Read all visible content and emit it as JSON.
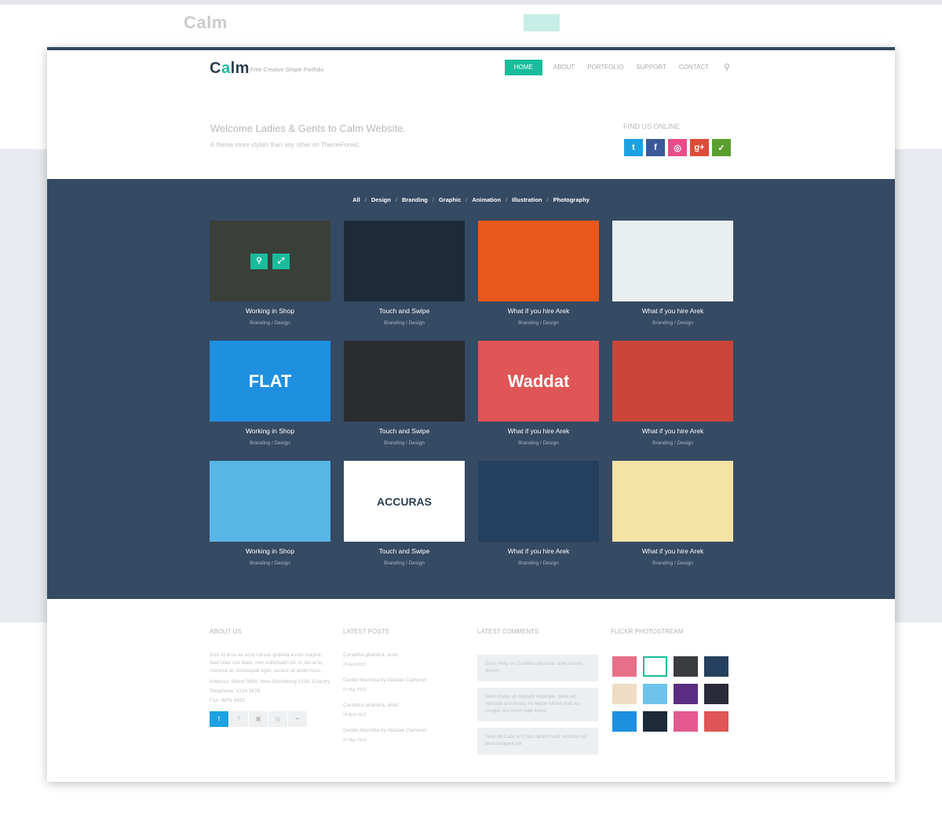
{
  "brand": {
    "logo_prefix": "C",
    "logo_accent": "a",
    "logo_suffix": "lm",
    "tagline": "Free Creative Simple Portfolio"
  },
  "nav": [
    {
      "label": "HOME",
      "active": true
    },
    {
      "label": "ABOUT"
    },
    {
      "label": "PORTFOLIO"
    },
    {
      "label": "SUPPORT"
    },
    {
      "label": "CONTACT"
    }
  ],
  "hero": {
    "title": "Welcome Ladies & Gents to Calm Website.",
    "subtitle": "A theme more stylish than any other on ThemeForest."
  },
  "find_us": {
    "label": "FIND US ONLINE",
    "icons": [
      {
        "name": "twitter",
        "glyph": "t",
        "color": "#1da1e2"
      },
      {
        "name": "facebook",
        "glyph": "f",
        "color": "#3b5998"
      },
      {
        "name": "dribbble",
        "glyph": "◎",
        "color": "#ea4c89"
      },
      {
        "name": "google-plus",
        "glyph": "g+",
        "color": "#dd4b39"
      },
      {
        "name": "envato",
        "glyph": "✓",
        "color": "#5a9e2f"
      }
    ]
  },
  "filters": [
    "All",
    "Design",
    "Branding",
    "Graphic",
    "Animation",
    "Illustration",
    "Photography"
  ],
  "portfolio": [
    {
      "title": "Working in Shop",
      "category": "Branding / Design",
      "color": "#3b3f3a"
    },
    {
      "title": "Touch and Swipe",
      "category": "Branding / Design",
      "color": "#1c2a3a"
    },
    {
      "title": "What if you hire Arek",
      "category": "Branding / Design",
      "color": "#e8581b"
    },
    {
      "title": "What if you hire Arek",
      "category": "Branding / Design",
      "color": "#e9eef0"
    },
    {
      "title": "Working in Shop",
      "category": "Branding / Design",
      "color": "#1f8fe0",
      "text": "FLAT"
    },
    {
      "title": "Touch and Swipe",
      "category": "Branding / Design",
      "color": "#2a2c30"
    },
    {
      "title": "What if you hire Arek",
      "category": "Branding / Design",
      "color": "#e05555",
      "text": "Waddat"
    },
    {
      "title": "What if you hire Arek",
      "category": "Branding / Design",
      "color": "#c9453a"
    },
    {
      "title": "Working in Shop",
      "category": "Branding / Design",
      "color": "#58b6e6"
    },
    {
      "title": "Touch and Swipe",
      "category": "Branding / Design",
      "color": "#ffffff",
      "text": "ACCURAS"
    },
    {
      "title": "What if you hire Arek",
      "category": "Branding / Design",
      "color": "#25405e"
    },
    {
      "title": "What if you hire Arek",
      "category": "Branding / Design",
      "color": "#f5e3a6"
    }
  ],
  "footer": {
    "about": {
      "heading": "ABOUT US",
      "text": "Duis id eros ac eros cursus gravida a non magna. Sed vitae nisl diam, non sollicitudin mi. In dui arcu, rhoncus ac consequat eget, cursus sit amet risus.",
      "address": "Address: Street 9890, New Something 1234, Country",
      "telephone": "Telephone: 1234 5678",
      "fax": "Fax: 9876 5432"
    },
    "posts": {
      "heading": "LATEST POSTS",
      "items": [
        {
          "title": "Curabitur pharetra, ante!",
          "date": "25 April 2013"
        },
        {
          "title": "Gentle Marimba by Alastair Cameron",
          "date": "01 May 2013"
        },
        {
          "title": "Curabitur pharetra, ante!",
          "date": "25 April 2013"
        },
        {
          "title": "Gentle Marimba by Alastair Cameron",
          "date": "01 May 2013"
        }
      ]
    },
    "comments": {
      "heading": "LATEST COMMENTS",
      "items": [
        "Dann Petty on Curabitur pharetra, ante lobortis dictum.",
        "Kevin Kalde on Aliquam vulputate, pede vel vehicula accumsan, mi neque rutrum erat, eu congue orci lorem eget lorem.",
        "Sean McCabe on Class aptent taciti sociosqu ad litora torquent per"
      ]
    },
    "flickr": {
      "heading": "FLICKR PHOTOSTREAM",
      "colors": [
        "#e86f88",
        "#ffffff",
        "#3a3b3f",
        "#25405e",
        "#f0dcc4",
        "#6fc3ea",
        "#5a2d82",
        "#2a2a3a",
        "#1f8fe0",
        "#1c2a3a",
        "#e45a90",
        "#e05555"
      ]
    },
    "social_icons": [
      "twitter",
      "facebook",
      "instagram",
      "dribbble",
      "flickr"
    ]
  }
}
